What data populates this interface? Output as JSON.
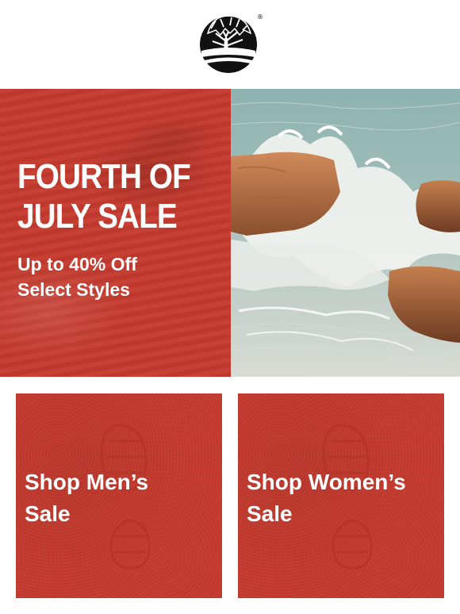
{
  "header": {
    "logo_icon": "timberland-tree-icon",
    "registered_mark": "®"
  },
  "hero": {
    "title_line1": "FOURTH OF",
    "title_line2": "JULY SALE",
    "subtitle_line1": "Up to 40% Off",
    "subtitle_line2": "Select Styles",
    "background_color": "#c43a2e",
    "image": "coastal-rocks-waves-photo"
  },
  "promos": [
    {
      "line1": "Shop Men’s",
      "line2": "Sale",
      "background_color": "#c43a2e"
    },
    {
      "line1": "Shop Women’s",
      "line2": "Sale",
      "background_color": "#c43a2e"
    }
  ]
}
